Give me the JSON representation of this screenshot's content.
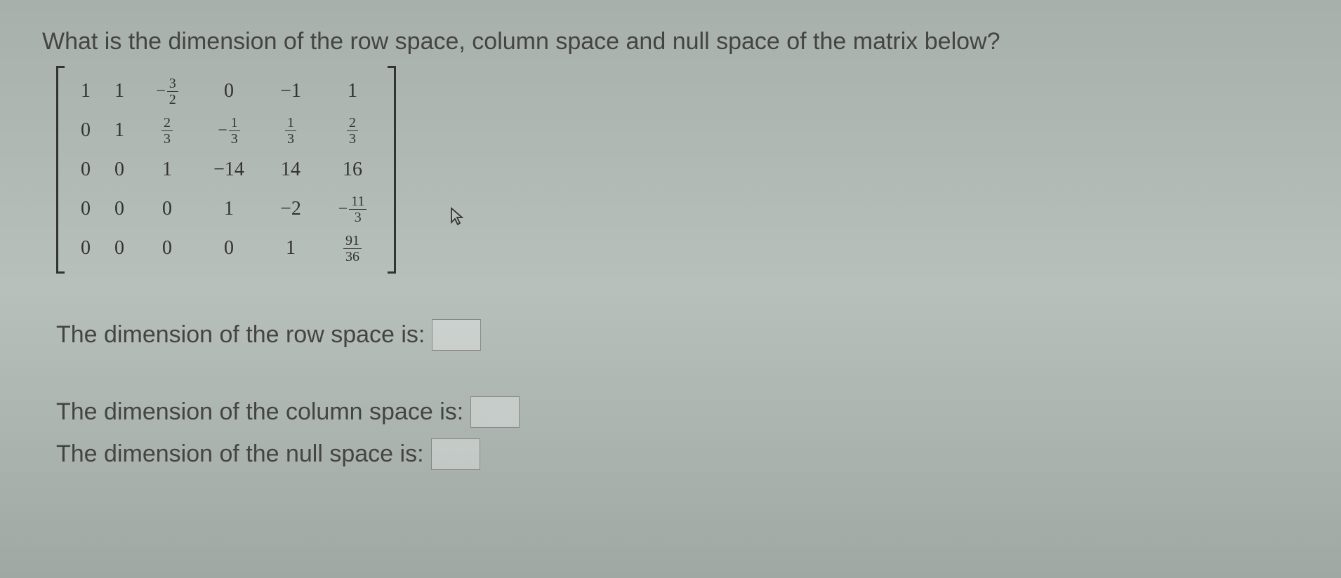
{
  "question": "What is the dimension of the row space, column space and null space of the matrix below?",
  "matrix": {
    "rows": [
      [
        "1",
        "1",
        {
          "neg": true,
          "num": "3",
          "den": "2"
        },
        "0",
        "−1",
        "1"
      ],
      [
        "0",
        "1",
        {
          "num": "2",
          "den": "3"
        },
        {
          "neg": true,
          "num": "1",
          "den": "3"
        },
        {
          "num": "1",
          "den": "3"
        },
        {
          "num": "2",
          "den": "3"
        }
      ],
      [
        "0",
        "0",
        "1",
        "−14",
        "14",
        "16"
      ],
      [
        "0",
        "0",
        "0",
        "1",
        "−2",
        {
          "neg": true,
          "num": "11",
          "den": "3"
        }
      ],
      [
        "0",
        "0",
        "0",
        "0",
        "1",
        {
          "num": "91",
          "den": "36"
        }
      ]
    ]
  },
  "answers": {
    "row_space_label": "The dimension of the row space is:",
    "column_space_label": "The dimension of the column space is:",
    "null_space_label": "The dimension of the null space is:",
    "row_space_value": "",
    "column_space_value": "",
    "null_space_value": ""
  },
  "cursor_glyph": "↖"
}
